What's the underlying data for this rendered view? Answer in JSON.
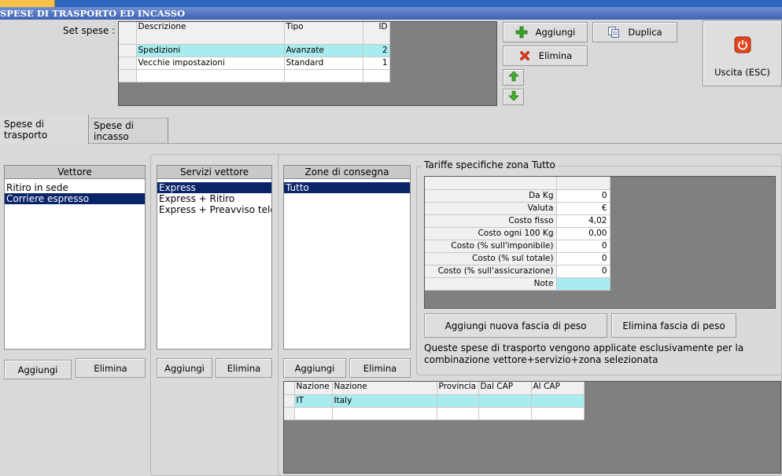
{
  "window": {
    "title": "SPESE DI TRASPORTO ED INCASSO"
  },
  "set_spese": {
    "label": "Set spese :",
    "columns": [
      "Descrizione",
      "Tipo",
      "ID"
    ],
    "rows": [
      {
        "descrizione": "Spedizioni",
        "tipo": "Avanzate",
        "id": "2",
        "selected": true
      },
      {
        "descrizione": "Vecchie impostazioni",
        "tipo": "Standard",
        "id": "1",
        "selected": false
      }
    ]
  },
  "toolbar": {
    "aggiungi": "Aggiungi",
    "duplica": "Duplica",
    "elimina": "Elimina",
    "uscita": "Uscita (ESC)"
  },
  "tabs": [
    {
      "label": "Spese di trasporto",
      "active": true
    },
    {
      "label": "Spese di incasso",
      "active": false
    }
  ],
  "vettore": {
    "header": "Vettore",
    "items": [
      {
        "label": "Ritiro in sede",
        "selected": false
      },
      {
        "label": "Corriere espresso",
        "selected": true
      }
    ],
    "add": "Aggiungi",
    "remove": "Elimina"
  },
  "servizi": {
    "header": "Servizi vettore",
    "items": [
      {
        "label": "Express",
        "selected": true
      },
      {
        "label": "Express + Ritiro",
        "selected": false
      },
      {
        "label": "Express + Preavviso telefc",
        "selected": false
      }
    ],
    "add": "Aggiungi",
    "remove": "Elimina"
  },
  "zone": {
    "header": "Zone di consegna",
    "items": [
      {
        "label": "Tutto",
        "selected": true
      }
    ],
    "add": "Aggiungi",
    "remove": "Elimina"
  },
  "tariffe": {
    "title": "Tariffe specifiche zona Tutto",
    "rows": [
      {
        "label": "Da Kg",
        "value": "0"
      },
      {
        "label": "Valuta",
        "value": "€"
      },
      {
        "label": "Costo fisso",
        "value": "4,02"
      },
      {
        "label": "Costo ogni 100 Kg",
        "value": "0,00"
      },
      {
        "label": "Costo (% sull'imponibile)",
        "value": "0"
      },
      {
        "label": "Costo (% sul totale)",
        "value": "0"
      },
      {
        "label": "Costo (% sull'assicurazione)",
        "value": "0"
      },
      {
        "label": "Note",
        "value": ""
      }
    ],
    "add_band": "Aggiungi nuova fascia di peso",
    "remove_band": "Elimina fascia di peso",
    "note_line1": "Queste spese di trasporto vengono applicate esclusivamente per la",
    "note_line2": "combinazione vettore+servizio+zona selezionata"
  },
  "nazioni": {
    "columns": [
      "Nazione",
      "Nazione",
      "Provincia",
      "Dal CAP",
      "Al CAP"
    ],
    "rows": [
      {
        "code": "IT",
        "name": "Italy",
        "provincia": "",
        "dal": "",
        "al": ""
      }
    ]
  },
  "colors": {
    "titlebar": "#3e62b4",
    "selection_cyan": "#a8ecf0",
    "selection_navy": "#0a246a",
    "grid_bg": "#808080"
  }
}
